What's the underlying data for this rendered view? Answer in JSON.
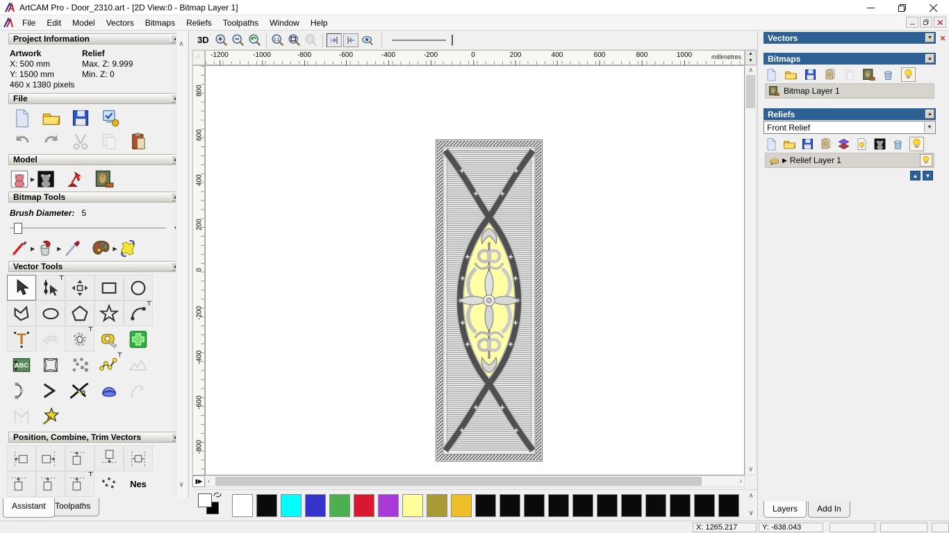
{
  "window": {
    "title": "ArtCAM Pro - Door_2310.art - [2D View:0 - Bitmap Layer 1]"
  },
  "menu": {
    "items": [
      "File",
      "Edit",
      "Model",
      "Vectors",
      "Bitmaps",
      "Reliefs",
      "Toolpaths",
      "Window",
      "Help"
    ]
  },
  "toolbar": {
    "view_3d_label": "3D",
    "icons": [
      "zoom-in-icon",
      "zoom-out-icon",
      "zoom-previous-icon",
      "zoom-1to1-icon",
      "zoom-fit-icon",
      "zoom-selection-icon",
      "snap-left-icon",
      "snap-right-icon",
      "preview-icon",
      "zoom-slider"
    ]
  },
  "assistant": {
    "project_information": {
      "title": "Project Information",
      "artwork_heading": "Artwork",
      "artwork_x": "X: 500 mm",
      "artwork_y": "Y: 1500 mm",
      "artwork_pixels": "460 x 1380 pixels",
      "relief_heading": "Relief",
      "relief_max": "Max. Z: 9.999",
      "relief_min": "Min. Z: 0"
    },
    "file": {
      "title": "File",
      "icons": [
        "new-model-icon",
        "open-model-icon",
        "save-model-icon",
        "model-notes-icon",
        "undo-icon",
        "redo-icon",
        "cut-icon",
        "copy-icon",
        "paste-icon"
      ]
    },
    "model": {
      "title": "Model",
      "icons": [
        "set-model-size-icon",
        "adjust-model-icon",
        "lighting-icon",
        "load-bitmap-icon"
      ]
    },
    "bitmap_tools": {
      "title": "Bitmap Tools",
      "brush_label": "Brush Diameter:",
      "brush_value": "5",
      "icons": [
        "paint-icon",
        "flood-fill-icon",
        "pick-colour-icon",
        "palette-icon",
        "colour-swap-icon"
      ]
    },
    "vector_tools": {
      "title": "Vector Tools",
      "icons": [
        "select-vectors-icon",
        "node-editing-icon",
        "transform-vectors-icon",
        "create-rectangle-icon",
        "create-circle-icon",
        "create-polyline-icon",
        "create-ellipse-icon",
        "create-polygon-icon",
        "create-star-icon",
        "create-arc-icon",
        "create-text-icon",
        "wrap-text-icon",
        "offset-vectors-icon",
        "measure-icon",
        "paste-vector-icon",
        "text-block-icon",
        "envelope-distort-icon",
        "block-nest-icon",
        "fit-polyline-icon",
        "simplify-vectors-icon",
        "fit-arcs-icon",
        "join-vectors-icon",
        "trim-vectors-icon",
        "wrap-vectors-icon",
        "unwrap-vectors-icon",
        "cross-section-icon",
        "spline-vectors-icon"
      ]
    },
    "position_tools": {
      "title": "Position, Combine, Trim Vectors",
      "icons": [
        "align-left-icon",
        "align-right-icon",
        "align-top-icon",
        "align-bottom-icon",
        "align-centre-icon"
      ],
      "nesting_label": "Nes"
    },
    "tabs": [
      {
        "label": "Assistant"
      },
      {
        "label": "Toolpaths"
      }
    ]
  },
  "ruler": {
    "unit_label": "millimetres",
    "top_labels": [
      "-1200",
      "-1000",
      "-800",
      "-600",
      "-400",
      "-200",
      "0",
      "200",
      "400",
      "600",
      "800",
      "1000"
    ],
    "left_labels": [
      "800",
      "600",
      "400",
      "200",
      "0",
      "-200",
      "-400",
      "-600",
      "-800"
    ]
  },
  "right_panel": {
    "vectors": {
      "title": "Vectors"
    },
    "bitmaps": {
      "title": "Bitmaps",
      "icons": [
        "new-bitmap-layer-icon",
        "open-bitmap-icon",
        "save-bitmap-icon",
        "merge-bitmap-icon",
        "clear-bitmap-icon",
        "bitmap-to-vector-icon",
        "delete-bitmap-icon",
        "toggle-visibility-icon"
      ],
      "layers": [
        {
          "name": "Bitmap Layer 1"
        }
      ]
    },
    "reliefs": {
      "title": "Reliefs",
      "selected": "Front Relief",
      "icons": [
        "new-relief-layer-icon",
        "open-relief-icon",
        "save-relief-icon",
        "merge-relief-icon",
        "stack-relief-icon",
        "relief-visibility-icon",
        "relief-greyscale-icon",
        "delete-relief-icon",
        "toggle-visibility-icon"
      ],
      "layers": [
        {
          "name": "Relief Layer 1"
        }
      ]
    },
    "tabs": [
      {
        "label": "Layers"
      },
      {
        "label": "Add In"
      }
    ]
  },
  "palette": {
    "primary": "#ffffff",
    "secondary": "#000000",
    "swatches": [
      "#ffffff",
      "#0a0a0a",
      "#00ffff",
      "#3333cc",
      "#4caf50",
      "#d8182e",
      "#a838d8",
      "#ffff99",
      "#a89b35",
      "#efbf2a",
      "#0a0a0a",
      "#0a0a0a",
      "#0a0a0a",
      "#0a0a0a",
      "#0a0a0a",
      "#0a0a0a",
      "#0a0a0a",
      "#0a0a0a",
      "#0a0a0a",
      "#0a0a0a",
      "#0a0a0a"
    ]
  },
  "status": {
    "cells": [
      "X: 1265.217",
      "Y: -638.043",
      "",
      "",
      ""
    ]
  },
  "artwork": {
    "description": "Door_2310 bitmap artwork: striped door panel with rope border, crossing dark bands forming a pointed oval, yellow centre with silver scroll ornament",
    "colors": {
      "background": "#ffffff",
      "stripes": "#a8a8a8",
      "bands": "#4f4f4f",
      "centre_fill": "#ffffa6",
      "ornament": "#c9c9c9"
    }
  }
}
